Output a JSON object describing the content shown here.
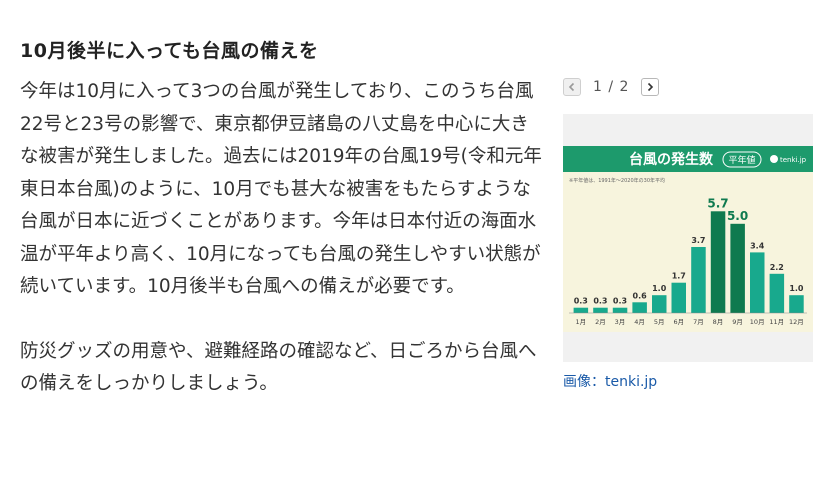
{
  "article": {
    "headline": "10月後半に入っても台風の備えを",
    "paragraph1": "今年は10月に入って3つの台風が発生しており、このうち台風22号と23号の影響で、東京都伊豆諸島の八丈島を中心に大きな被害が発生しました。過去には2019年の台風19号(令和元年東日本台風)のように、10月でも甚大な被害をもたらすような台風が日本に近づくことがあります。今年は日本付近の海面水温が平年より高く、10月になっても台風の発生しやすい状態が続いています。10月後半も台風への備えが必要です。",
    "paragraph2": "防災グッズの用意や、避難経路の確認など、日ごろから台風への備えをしっかりしましょう。"
  },
  "gallery": {
    "counter": "1 / 2",
    "caption": "画像：tenki.jp",
    "prev_icon": "chevron-left-icon",
    "next_icon": "chevron-right-icon"
  },
  "chart_data": {
    "type": "bar",
    "title": "台風の発生数",
    "badge": "平年値",
    "brand": "tenki.jp",
    "note": "※平年値は、1991年～2020年の30年平均",
    "categories": [
      "1月",
      "2月",
      "3月",
      "4月",
      "5月",
      "6月",
      "7月",
      "8月",
      "9月",
      "10月",
      "11月",
      "12月"
    ],
    "values": [
      0.3,
      0.3,
      0.3,
      0.6,
      1.0,
      1.7,
      3.7,
      5.7,
      5.0,
      3.4,
      2.2,
      1.0
    ],
    "ylim": [
      0,
      6
    ],
    "grid": false,
    "colors": {
      "header": "#1d9a6c",
      "bar": "#18a98d",
      "bar_peak": "#0f7a4f",
      "background": "#f7f4dd"
    }
  }
}
